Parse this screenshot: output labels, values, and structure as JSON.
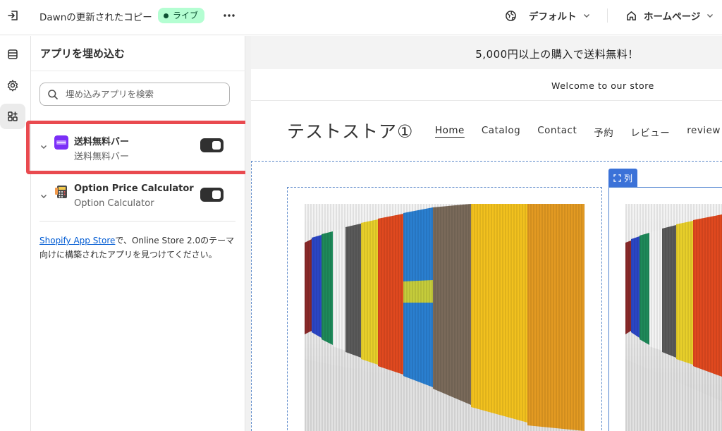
{
  "topbar": {
    "theme_title": "Dawnの更新されたコピー",
    "live_label": "ライブ",
    "more_label": "•••",
    "default_label": "デフォルト",
    "home_label": "ホームページ"
  },
  "panel": {
    "title": "アプリを埋め込む",
    "search_placeholder": "埋め込みアプリを検索",
    "apps": [
      {
        "name": "送料無料バー",
        "subtitle": "送料無料バー",
        "enabled": true,
        "icon": "free-shipping-bar-app-icon"
      },
      {
        "name": "Option Price Calculator",
        "subtitle": "Option Calculator",
        "enabled": true,
        "icon": "calculator-app-icon"
      }
    ],
    "footnote_link": "Shopify App Store",
    "footnote_text": "で、Online Store 2.0のテーマ向けに構築されたアプリを見つけてください。"
  },
  "preview": {
    "announcement": "5,000円以上の購入で送料無料！",
    "welcome": "Welcome to our store",
    "store_name": "テストストア①",
    "nav": [
      "Home",
      "Catalog",
      "Contact",
      "予約",
      "レビュー",
      "review"
    ],
    "column_tag": "列"
  },
  "colors": {
    "live_badge_bg": "#b4fed2",
    "highlight_border": "#e94a4f",
    "link": "#005bd3",
    "column_tag": "#3b72d8"
  }
}
